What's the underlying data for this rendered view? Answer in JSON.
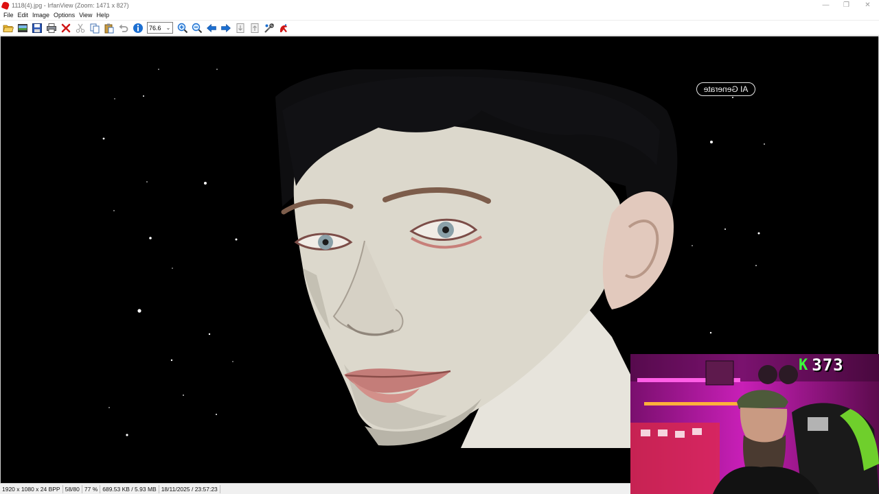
{
  "window": {
    "title": "1118(4).jpg - IrfanView (Zoom: 1471 x 827)",
    "app_icon": "irfanview-cat-icon",
    "controls": {
      "minimize": "—",
      "restore": "❐",
      "close": "✕"
    }
  },
  "menu": {
    "items": [
      "File",
      "Edit",
      "Image",
      "Options",
      "View",
      "Help"
    ]
  },
  "toolbar": {
    "buttons": [
      "open-folder-icon",
      "thumbnails-icon",
      "save-icon",
      "print-icon",
      "delete-icon",
      "cut-icon",
      "copy-icon",
      "paste-icon",
      "undo-icon",
      "info-icon"
    ],
    "zoom_value": "76.6",
    "buttons_after_zoom": [
      "zoom-in-icon",
      "zoom-out-icon",
      "previous-icon",
      "next-icon",
      "first-page-icon",
      "last-page-icon",
      "settings-icon",
      "plugin-icon"
    ],
    "colors": {
      "blue": "#1c6fd1",
      "red": "#d01717",
      "yellow": "#f2b81c"
    }
  },
  "image": {
    "watermark": "AI Generate",
    "background": "#000000"
  },
  "webcam": {
    "badge_letter": "K",
    "badge_count": "373",
    "badge_color": "#3bff3b",
    "lighting": "#ff2bd6"
  },
  "status": {
    "dimensions": "1920 x 1080 x 24 BPP",
    "index": "58/80",
    "zoom": "77 %",
    "size": "689.53 KB / 5.93 MB",
    "datetime": "18/11/2025 / 23:57:23"
  }
}
